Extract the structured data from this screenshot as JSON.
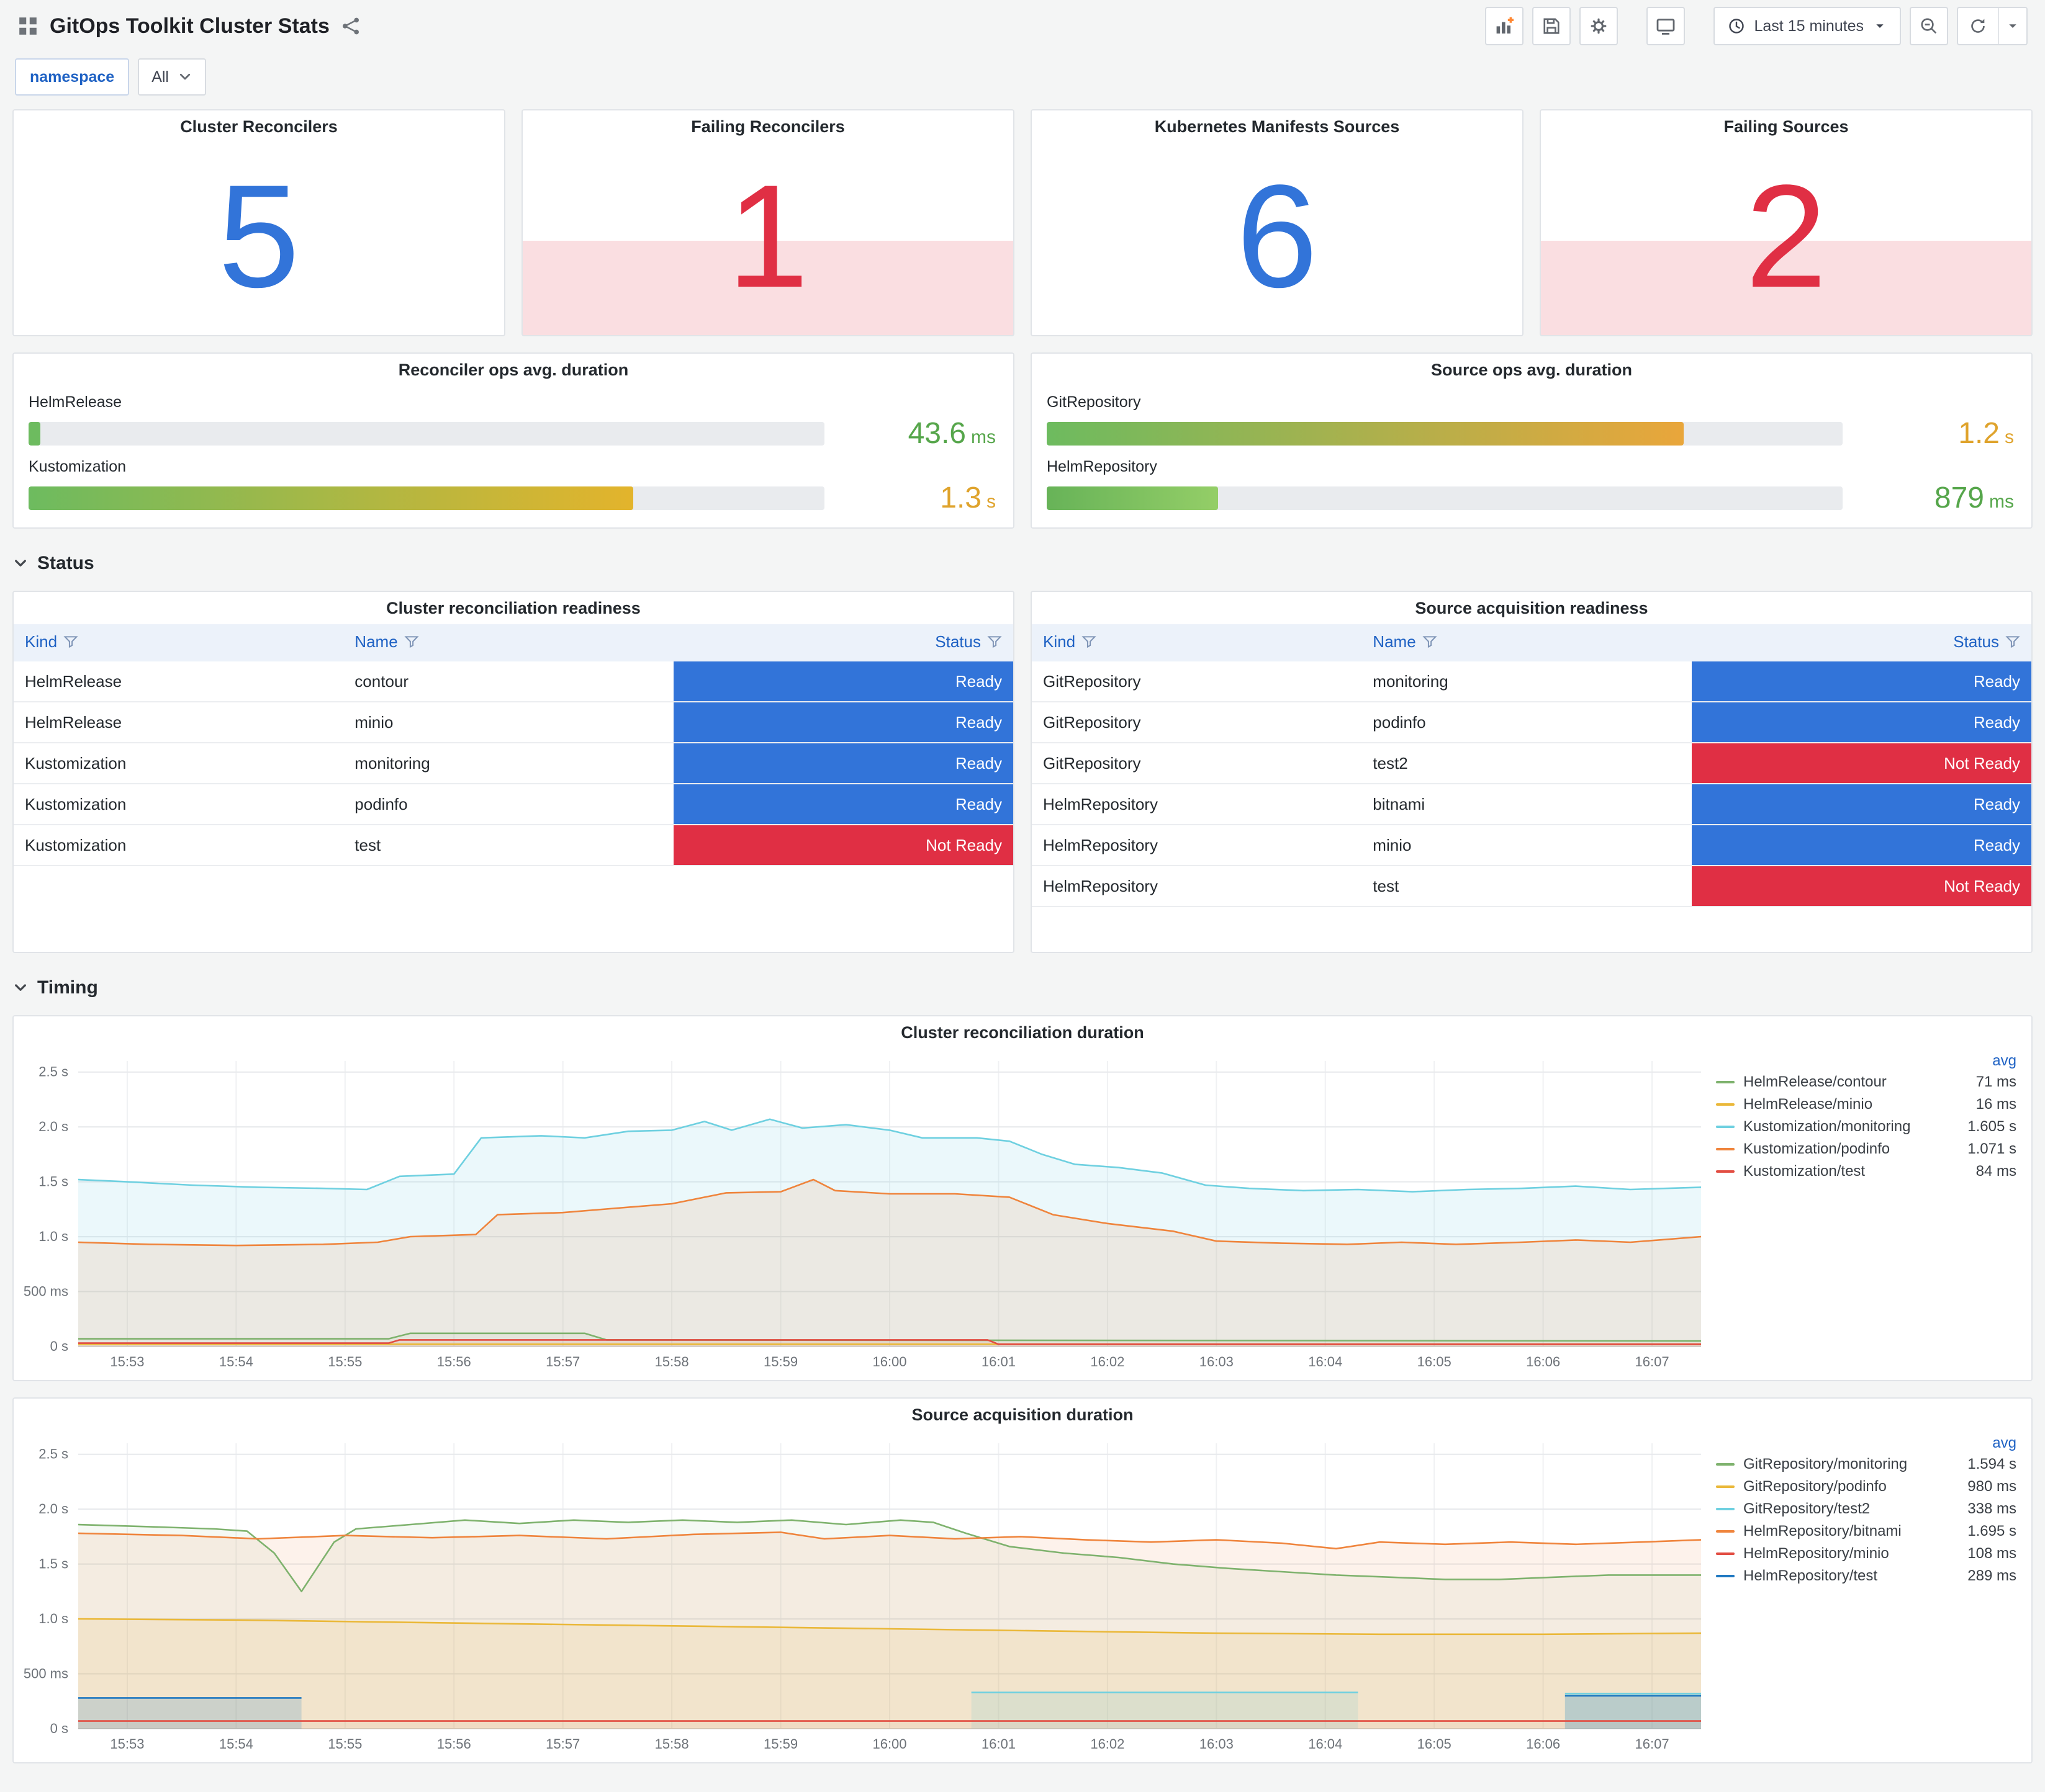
{
  "header": {
    "title": "GitOps Toolkit Cluster Stats",
    "time_picker": "Last 15 minutes",
    "toolbar_icons": [
      "panel-add",
      "save",
      "gear",
      "tv"
    ],
    "extra_icons": [
      "search-minus",
      "refresh",
      "caret-down"
    ]
  },
  "variables": [
    {
      "label": "namespace",
      "value": "All"
    }
  ],
  "sections": [
    {
      "title": "Status"
    },
    {
      "title": "Timing"
    }
  ],
  "colors": {
    "stat_ok": "#3274d9",
    "stat_alert": "#e02f44",
    "green": "#56a64b",
    "yellow": "#dfa32c"
  },
  "status_colors": {
    "Ready": "#3274d9",
    "Not Ready": "#e02f44"
  },
  "stat_panels": [
    {
      "title": "Cluster Reconcilers",
      "value": "5",
      "state": "ok",
      "value_color": "#3274d9"
    },
    {
      "title": "Failing Reconcilers",
      "value": "1",
      "state": "alert",
      "value_color": "#e02f44"
    },
    {
      "title": "Kubernetes Manifests Sources",
      "value": "6",
      "state": "ok",
      "value_color": "#3274d9"
    },
    {
      "title": "Failing Sources",
      "value": "2",
      "state": "alert",
      "value_color": "#e02f44"
    }
  ],
  "gauge_panels": [
    {
      "title": "Reconciler ops avg. duration",
      "rows": [
        {
          "label": "HelmRelease",
          "value": "43.6",
          "unit": "ms",
          "pct": 1.5,
          "value_color": "#56a64b",
          "bar": [
            "#6dbb5f",
            "#6dbb5f"
          ]
        },
        {
          "label": "Kustomization",
          "value": "1.3",
          "unit": "s",
          "pct": 76,
          "value_color": "#dfa32c",
          "bar": [
            "#6dbb5f",
            "#e3b42c"
          ]
        }
      ]
    },
    {
      "title": "Source ops avg. duration",
      "rows": [
        {
          "label": "GitRepository",
          "value": "1.2",
          "unit": "s",
          "pct": 80,
          "value_color": "#dfa32c",
          "bar": [
            "#6dbb5f",
            "#e9a63b"
          ]
        },
        {
          "label": "HelmRepository",
          "value": "879",
          "unit": "ms",
          "pct": 21.5,
          "value_color": "#56a64b",
          "bar": [
            "#67b358",
            "#94ce67"
          ]
        }
      ]
    }
  ],
  "tables": [
    {
      "title": "Cluster reconciliation readiness",
      "columns": [
        "Kind",
        "Name",
        "Status"
      ],
      "rows": [
        [
          "HelmRelease",
          "contour",
          "Ready"
        ],
        [
          "HelmRelease",
          "minio",
          "Ready"
        ],
        [
          "Kustomization",
          "monitoring",
          "Ready"
        ],
        [
          "Kustomization",
          "podinfo",
          "Ready"
        ],
        [
          "Kustomization",
          "test",
          "Not Ready"
        ]
      ]
    },
    {
      "title": "Source acquisition readiness",
      "columns": [
        "Kind",
        "Name",
        "Status"
      ],
      "rows": [
        [
          "GitRepository",
          "monitoring",
          "Ready"
        ],
        [
          "GitRepository",
          "podinfo",
          "Ready"
        ],
        [
          "GitRepository",
          "test2",
          "Not Ready"
        ],
        [
          "HelmRepository",
          "bitnami",
          "Ready"
        ],
        [
          "HelmRepository",
          "minio",
          "Ready"
        ],
        [
          "HelmRepository",
          "test",
          "Not Ready"
        ]
      ]
    }
  ],
  "chart_data": [
    {
      "type": "area",
      "title": "Cluster reconciliation duration",
      "legend_header": "avg",
      "xmin": 0.55,
      "xmax": 15.45,
      "ymax": 2.6,
      "x_ticks": [
        "15:53",
        "15:54",
        "15:55",
        "15:56",
        "15:57",
        "15:58",
        "15:59",
        "16:00",
        "16:01",
        "16:02",
        "16:03",
        "16:04",
        "16:05",
        "16:06",
        "16:07"
      ],
      "y_grid": [
        0,
        0.5,
        1.0,
        1.5,
        2.0,
        2.5
      ],
      "y_ticks": [
        "0 s",
        "500 ms",
        "1.0 s",
        "1.5 s",
        "2.0 s",
        "2.5 s"
      ],
      "series": [
        {
          "name": "HelmRelease/contour",
          "avg": "71 ms",
          "color": "#7eb26d",
          "fill_opacity": 0.06,
          "points": [
            [
              0.55,
              0.07
            ],
            [
              3.4,
              0.07
            ],
            [
              3.6,
              0.12
            ],
            [
              5.2,
              0.12
            ],
            [
              5.4,
              0.06
            ],
            [
              15.45,
              0.05
            ]
          ]
        },
        {
          "name": "HelmRelease/minio",
          "avg": "16 ms",
          "color": "#eab839",
          "fill_opacity": 0.05,
          "points": [
            [
              0.55,
              0.02
            ],
            [
              15.45,
              0.02
            ]
          ]
        },
        {
          "name": "Kustomization/monitoring",
          "avg": "1.605 s",
          "color": "#6ed0e0",
          "fill_opacity": 0.14,
          "points": [
            [
              0.55,
              1.52
            ],
            [
              1,
              1.5
            ],
            [
              1.6,
              1.47
            ],
            [
              2.2,
              1.45
            ],
            [
              2.8,
              1.44
            ],
            [
              3.2,
              1.43
            ],
            [
              3.5,
              1.55
            ],
            [
              4.0,
              1.57
            ],
            [
              4.25,
              1.9
            ],
            [
              4.8,
              1.92
            ],
            [
              5.2,
              1.9
            ],
            [
              5.6,
              1.96
            ],
            [
              6.0,
              1.97
            ],
            [
              6.3,
              2.05
            ],
            [
              6.55,
              1.97
            ],
            [
              6.9,
              2.07
            ],
            [
              7.2,
              1.99
            ],
            [
              7.6,
              2.02
            ],
            [
              8.0,
              1.97
            ],
            [
              8.3,
              1.9
            ],
            [
              8.8,
              1.9
            ],
            [
              9.1,
              1.87
            ],
            [
              9.4,
              1.75
            ],
            [
              9.7,
              1.66
            ],
            [
              10.1,
              1.63
            ],
            [
              10.5,
              1.58
            ],
            [
              10.9,
              1.47
            ],
            [
              11.3,
              1.44
            ],
            [
              11.8,
              1.42
            ],
            [
              12.3,
              1.43
            ],
            [
              12.8,
              1.41
            ],
            [
              13.3,
              1.43
            ],
            [
              13.8,
              1.44
            ],
            [
              14.3,
              1.46
            ],
            [
              14.8,
              1.43
            ],
            [
              15.45,
              1.45
            ]
          ]
        },
        {
          "name": "Kustomization/podinfo",
          "avg": "1.071 s",
          "color": "#ef843c",
          "fill_opacity": 0.12,
          "points": [
            [
              0.55,
              0.95
            ],
            [
              1.2,
              0.93
            ],
            [
              2,
              0.92
            ],
            [
              2.8,
              0.93
            ],
            [
              3.3,
              0.95
            ],
            [
              3.6,
              1.0
            ],
            [
              4.2,
              1.02
            ],
            [
              4.4,
              1.2
            ],
            [
              5,
              1.22
            ],
            [
              5.5,
              1.26
            ],
            [
              6,
              1.3
            ],
            [
              6.5,
              1.4
            ],
            [
              7,
              1.41
            ],
            [
              7.3,
              1.52
            ],
            [
              7.5,
              1.42
            ],
            [
              8,
              1.39
            ],
            [
              8.6,
              1.39
            ],
            [
              9.1,
              1.36
            ],
            [
              9.5,
              1.2
            ],
            [
              10,
              1.12
            ],
            [
              10.6,
              1.05
            ],
            [
              11,
              0.96
            ],
            [
              11.6,
              0.94
            ],
            [
              12.2,
              0.93
            ],
            [
              12.7,
              0.95
            ],
            [
              13.2,
              0.93
            ],
            [
              13.8,
              0.95
            ],
            [
              14.3,
              0.97
            ],
            [
              14.8,
              0.95
            ],
            [
              15.45,
              1.0
            ]
          ]
        },
        {
          "name": "Kustomization/test",
          "avg": "84 ms",
          "color": "#e24d42",
          "fill_opacity": 0.1,
          "points": [
            [
              0.55,
              0.03
            ],
            [
              3.4,
              0.03
            ],
            [
              3.5,
              0.06
            ],
            [
              8.9,
              0.06
            ],
            [
              9.0,
              0.02
            ],
            [
              15.45,
              0.02
            ]
          ]
        }
      ]
    },
    {
      "type": "area",
      "title": "Source acquisition duration",
      "legend_header": "avg",
      "xmin": 0.55,
      "xmax": 15.45,
      "ymax": 2.6,
      "x_ticks": [
        "15:53",
        "15:54",
        "15:55",
        "15:56",
        "15:57",
        "15:58",
        "15:59",
        "16:00",
        "16:01",
        "16:02",
        "16:03",
        "16:04",
        "16:05",
        "16:06",
        "16:07"
      ],
      "y_grid": [
        0,
        0.5,
        1.0,
        1.5,
        2.0,
        2.5
      ],
      "y_ticks": [
        "0 s",
        "500 ms",
        "1.0 s",
        "1.5 s",
        "2.0 s",
        "2.5 s"
      ],
      "series": [
        {
          "name": "GitRepository/monitoring",
          "avg": "1.594 s",
          "color": "#7eb26d",
          "fill_opacity": 0.08,
          "points": [
            [
              0.55,
              1.86
            ],
            [
              1.2,
              1.84
            ],
            [
              1.8,
              1.82
            ],
            [
              2.1,
              1.8
            ],
            [
              2.35,
              1.6
            ],
            [
              2.6,
              1.25
            ],
            [
              2.9,
              1.7
            ],
            [
              3.1,
              1.82
            ],
            [
              3.6,
              1.86
            ],
            [
              4.1,
              1.9
            ],
            [
              4.6,
              1.87
            ],
            [
              5.1,
              1.9
            ],
            [
              5.6,
              1.88
            ],
            [
              6.1,
              1.9
            ],
            [
              6.6,
              1.88
            ],
            [
              7.1,
              1.9
            ],
            [
              7.6,
              1.86
            ],
            [
              8.1,
              1.9
            ],
            [
              8.4,
              1.88
            ],
            [
              8.7,
              1.78
            ],
            [
              9.1,
              1.66
            ],
            [
              9.6,
              1.6
            ],
            [
              10.1,
              1.56
            ],
            [
              10.6,
              1.5
            ],
            [
              11.1,
              1.46
            ],
            [
              11.6,
              1.43
            ],
            [
              12.1,
              1.4
            ],
            [
              12.6,
              1.38
            ],
            [
              13.1,
              1.36
            ],
            [
              13.6,
              1.36
            ],
            [
              14.1,
              1.38
            ],
            [
              14.6,
              1.4
            ],
            [
              15.45,
              1.4
            ]
          ]
        },
        {
          "name": "GitRepository/podinfo",
          "avg": "980 ms",
          "color": "#eab839",
          "fill_opacity": 0.12,
          "points": [
            [
              0.55,
              1.0
            ],
            [
              2,
              0.99
            ],
            [
              3.5,
              0.97
            ],
            [
              5,
              0.95
            ],
            [
              6.5,
              0.93
            ],
            [
              8,
              0.91
            ],
            [
              9.5,
              0.89
            ],
            [
              11,
              0.87
            ],
            [
              12.5,
              0.86
            ],
            [
              14,
              0.86
            ],
            [
              15.45,
              0.87
            ]
          ]
        },
        {
          "name": "GitRepository/test2",
          "avg": "338 ms",
          "color": "#6ed0e0",
          "fill_opacity": 0.18,
          "points": [
            [
              8.75,
              0.33
            ],
            [
              12.3,
              0.33
            ],
            null,
            [
              14.2,
              0.32
            ],
            [
              15.45,
              0.32
            ]
          ]
        },
        {
          "name": "HelmRepository/bitnami",
          "avg": "1.695 s",
          "color": "#ef843c",
          "fill_opacity": 0.1,
          "points": [
            [
              0.55,
              1.78
            ],
            [
              1.5,
              1.76
            ],
            [
              2.2,
              1.73
            ],
            [
              3,
              1.76
            ],
            [
              3.8,
              1.74
            ],
            [
              4.6,
              1.76
            ],
            [
              5.4,
              1.73
            ],
            [
              6.2,
              1.77
            ],
            [
              7,
              1.79
            ],
            [
              7.4,
              1.73
            ],
            [
              8,
              1.76
            ],
            [
              8.6,
              1.73
            ],
            [
              9.2,
              1.75
            ],
            [
              9.8,
              1.72
            ],
            [
              10.4,
              1.7
            ],
            [
              11,
              1.72
            ],
            [
              11.6,
              1.69
            ],
            [
              12.1,
              1.64
            ],
            [
              12.5,
              1.7
            ],
            [
              13.1,
              1.68
            ],
            [
              13.7,
              1.7
            ],
            [
              14.3,
              1.68
            ],
            [
              14.9,
              1.7
            ],
            [
              15.45,
              1.72
            ]
          ]
        },
        {
          "name": "HelmRepository/minio",
          "avg": "108 ms",
          "color": "#e24d42",
          "fill_opacity": 0.06,
          "points": [
            [
              0.55,
              0.07
            ],
            [
              15.45,
              0.07
            ]
          ]
        },
        {
          "name": "HelmRepository/test",
          "avg": "289 ms",
          "color": "#1f78c1",
          "fill_opacity": 0.18,
          "points": [
            [
              0.55,
              0.28
            ],
            [
              2.6,
              0.28
            ],
            null,
            [
              14.2,
              0.3
            ],
            [
              15.45,
              0.3
            ]
          ]
        }
      ]
    }
  ]
}
